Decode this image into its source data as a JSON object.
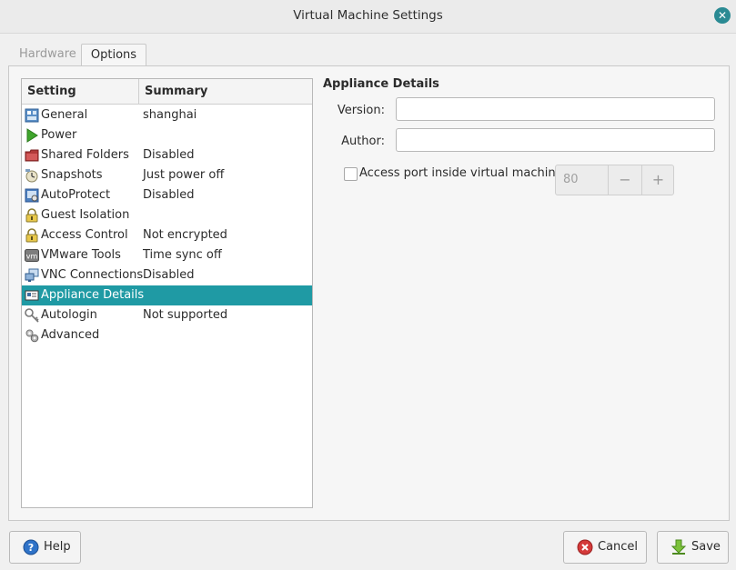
{
  "window": {
    "title": "Virtual Machine Settings"
  },
  "tabs": [
    {
      "label": "Hardware"
    },
    {
      "label": "Options"
    }
  ],
  "list": {
    "headers": {
      "setting": "Setting",
      "summary": "Summary"
    },
    "rows": [
      {
        "setting": "General",
        "summary": "shanghai",
        "icon": "general-icon"
      },
      {
        "setting": "Power",
        "summary": "",
        "icon": "power-icon"
      },
      {
        "setting": "Shared Folders",
        "summary": "Disabled",
        "icon": "shared-folders-icon"
      },
      {
        "setting": "Snapshots",
        "summary": "Just power off",
        "icon": "snapshots-icon"
      },
      {
        "setting": "AutoProtect",
        "summary": "Disabled",
        "icon": "autoprotect-icon"
      },
      {
        "setting": "Guest Isolation",
        "summary": "",
        "icon": "lock-icon"
      },
      {
        "setting": "Access Control",
        "summary": "Not encrypted",
        "icon": "lock-icon"
      },
      {
        "setting": "VMware Tools",
        "summary": "Time sync off",
        "icon": "vmware-tools-icon"
      },
      {
        "setting": "VNC Connections",
        "summary": "Disabled",
        "icon": "vnc-icon"
      },
      {
        "setting": "Appliance Details",
        "summary": "",
        "icon": "appliance-icon",
        "selected": true
      },
      {
        "setting": "Autologin",
        "summary": "Not supported",
        "icon": "autologin-icon"
      },
      {
        "setting": "Advanced",
        "summary": "",
        "icon": "advanced-icon"
      }
    ]
  },
  "details": {
    "title": "Appliance Details",
    "version_label": "Version:",
    "version_value": "",
    "author_label": "Author:",
    "author_value": "",
    "access_port_label": "Access port inside virtual machine:",
    "access_port_checked": false,
    "port_value": "80",
    "minus": "−",
    "plus": "+"
  },
  "buttons": {
    "help": "Help",
    "cancel": "Cancel",
    "save": "Save"
  },
  "colors": {
    "selection": "#1f9aa4",
    "accent": "#2a8a93"
  }
}
